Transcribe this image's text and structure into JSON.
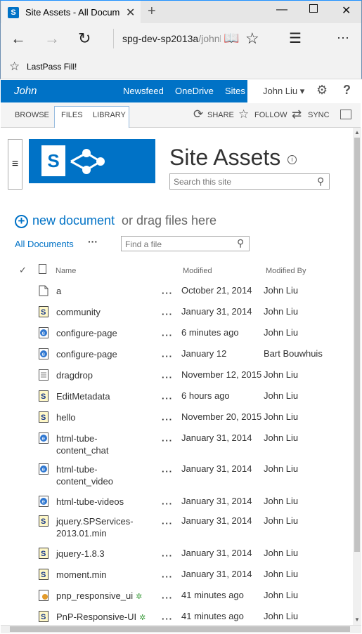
{
  "browser": {
    "tab_title": "Site Assets - All Documents",
    "tab_favicon": "S",
    "address_main": "spg-dev-sp2013a",
    "address_rest": "/johnliu",
    "favorite_item": "LastPass Fill!"
  },
  "suite": {
    "brand": "John",
    "links": [
      "Newsfeed",
      "OneDrive",
      "Sites"
    ],
    "user": "John Liu ▾"
  },
  "ribbon": {
    "tabs": [
      "BROWSE",
      "FILES",
      "LIBRARY"
    ],
    "actions": [
      "SHARE",
      "FOLLOW",
      "SYNC"
    ]
  },
  "page": {
    "title": "Site Assets",
    "search_placeholder": "Search this site",
    "new_document": "new document",
    "drag_text": "or drag files here",
    "view_name": "All Documents",
    "find_placeholder": "Find a file"
  },
  "list": {
    "columns": {
      "name": "Name",
      "modified": "Modified",
      "modified_by": "Modified By"
    },
    "rows": [
      {
        "name": "a",
        "modified": "October 21, 2014",
        "by": "John Liu",
        "icon": "generic-file-icon",
        "new": false
      },
      {
        "name": "community",
        "modified": "January 31, 2014",
        "by": "John Liu",
        "icon": "script-file-icon",
        "new": false
      },
      {
        "name": "configure-page",
        "modified": "6 minutes ago",
        "by": "John Liu",
        "icon": "html-file-icon",
        "new": false
      },
      {
        "name": "configure-page",
        "modified": "January 12",
        "by": "Bart Bouwhuis",
        "icon": "html-file-icon",
        "new": false
      },
      {
        "name": "dragdrop",
        "modified": "November 12, 2015",
        "by": "John Liu",
        "icon": "text-file-icon",
        "new": false
      },
      {
        "name": "EditMetadata",
        "modified": "6 hours ago",
        "by": "John Liu",
        "icon": "script-file-icon",
        "new": false
      },
      {
        "name": "hello",
        "modified": "November 20, 2015",
        "by": "John Liu",
        "icon": "script-file-icon",
        "new": false
      },
      {
        "name": "html-tube-\ncontent_chat",
        "modified": "January 31, 2014",
        "by": "John Liu",
        "icon": "html-file-icon",
        "new": false
      },
      {
        "name": "html-tube-\ncontent_video",
        "modified": "January 31, 2014",
        "by": "John Liu",
        "icon": "html-file-icon",
        "new": false
      },
      {
        "name": "html-tube-videos",
        "modified": "January 31, 2014",
        "by": "John Liu",
        "icon": "html-file-icon",
        "new": false
      },
      {
        "name": "jquery.SPServices-\n2013.01.min",
        "modified": "January 31, 2014",
        "by": "John Liu",
        "icon": "script-file-icon",
        "new": false
      },
      {
        "name": "jquery-1.8.3",
        "modified": "January 31, 2014",
        "by": "John Liu",
        "icon": "script-file-icon",
        "new": false
      },
      {
        "name": "moment.min",
        "modified": "January 31, 2014",
        "by": "John Liu",
        "icon": "script-file-icon",
        "new": false
      },
      {
        "name": "pnp_responsive_ui",
        "modified": "41 minutes ago",
        "by": "John Liu",
        "icon": "config-file-icon",
        "new": true
      },
      {
        "name": "PnP-Responsive-UI",
        "modified": "41 minutes ago",
        "by": "John Liu",
        "icon": "script-file-icon",
        "new": true
      }
    ]
  },
  "colors": {
    "brand_blue": "#0072c6",
    "new_badge": "#3a9a3a"
  }
}
